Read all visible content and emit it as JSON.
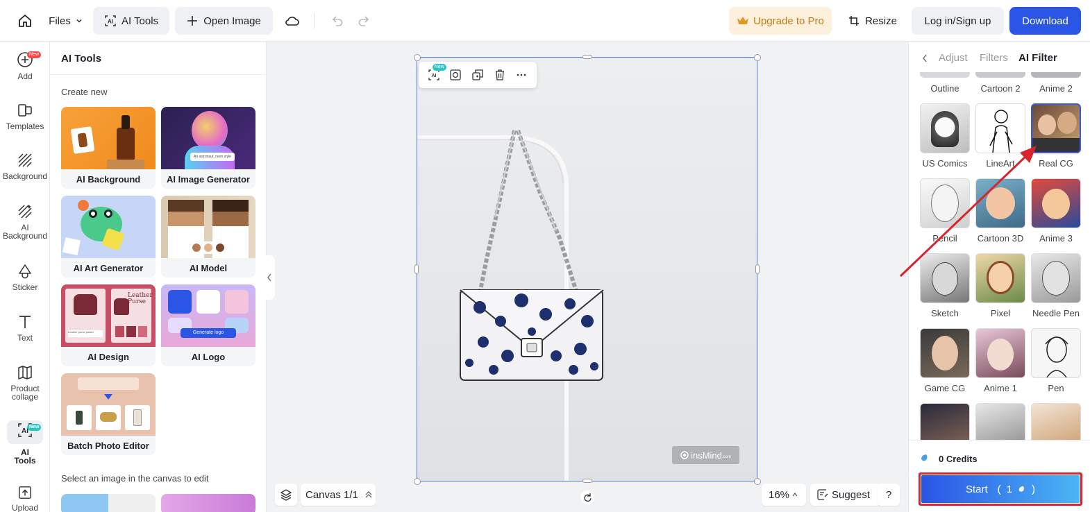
{
  "topbar": {
    "files_label": "Files",
    "ai_tools_label": "AI Tools",
    "open_image_label": "Open Image",
    "upgrade_label": "Upgrade to Pro",
    "resize_label": "Resize",
    "login_label": "Log in/Sign up",
    "download_label": "Download"
  },
  "leftnav": {
    "new_badge": "New",
    "items": [
      {
        "label": "Add"
      },
      {
        "label": "Templates"
      },
      {
        "label": "Background"
      },
      {
        "label": "AI Background"
      },
      {
        "label": "Sticker"
      },
      {
        "label": "Text"
      },
      {
        "label": "Product collage"
      },
      {
        "label": "AI Tools"
      },
      {
        "label": "Upload"
      }
    ]
  },
  "panel": {
    "title": "AI Tools",
    "create_new": "Create new",
    "cards": [
      {
        "label": "AI Background"
      },
      {
        "label": "AI Image Generator"
      },
      {
        "label": "AI Art Generator"
      },
      {
        "label": "AI Model"
      },
      {
        "label": "AI Design"
      },
      {
        "label": "AI Logo"
      },
      {
        "label": "Batch Photo Editor"
      }
    ],
    "select_hint": "Select an image in the canvas to edit",
    "thumb_texts": {
      "leather_title": "Leather Purse",
      "leather_prompt": "Leather purse poster",
      "logo_button": "Generate logo",
      "logo_brand": "insMind",
      "astro_prompt": "An astronaut, neon style"
    }
  },
  "canvas": {
    "toolbar_badge": "New",
    "canvas_label": "Canvas 1/1",
    "zoom_label": "16%",
    "suggest_label": "Suggest",
    "help_label": "?",
    "watermark": "insMind",
    "watermark_suffix": ".com"
  },
  "rightpanel": {
    "tabs": [
      "Adjust",
      "Filters",
      "AI Filter"
    ],
    "top_row": [
      "Outline",
      "Cartoon 2",
      "Anime 2"
    ],
    "filters": [
      {
        "label": "US Comics"
      },
      {
        "label": "LineArt"
      },
      {
        "label": "Real CG"
      },
      {
        "label": "Pencil"
      },
      {
        "label": "Cartoon 3D"
      },
      {
        "label": "Anime 3"
      },
      {
        "label": "Sketch"
      },
      {
        "label": "Pixel"
      },
      {
        "label": "Needle Pen"
      },
      {
        "label": "Game CG"
      },
      {
        "label": "Anime 1"
      },
      {
        "label": "Pen"
      }
    ],
    "credits_label": "0 Credits",
    "start_label": "Start",
    "start_cost": "1"
  },
  "colors": {
    "primary": "#2a55e5",
    "upgrade_bg": "#fdf0dc",
    "upgrade_text": "#c27a12",
    "annotation_red": "#d8242c",
    "selection_blue": "#4a74d8"
  }
}
